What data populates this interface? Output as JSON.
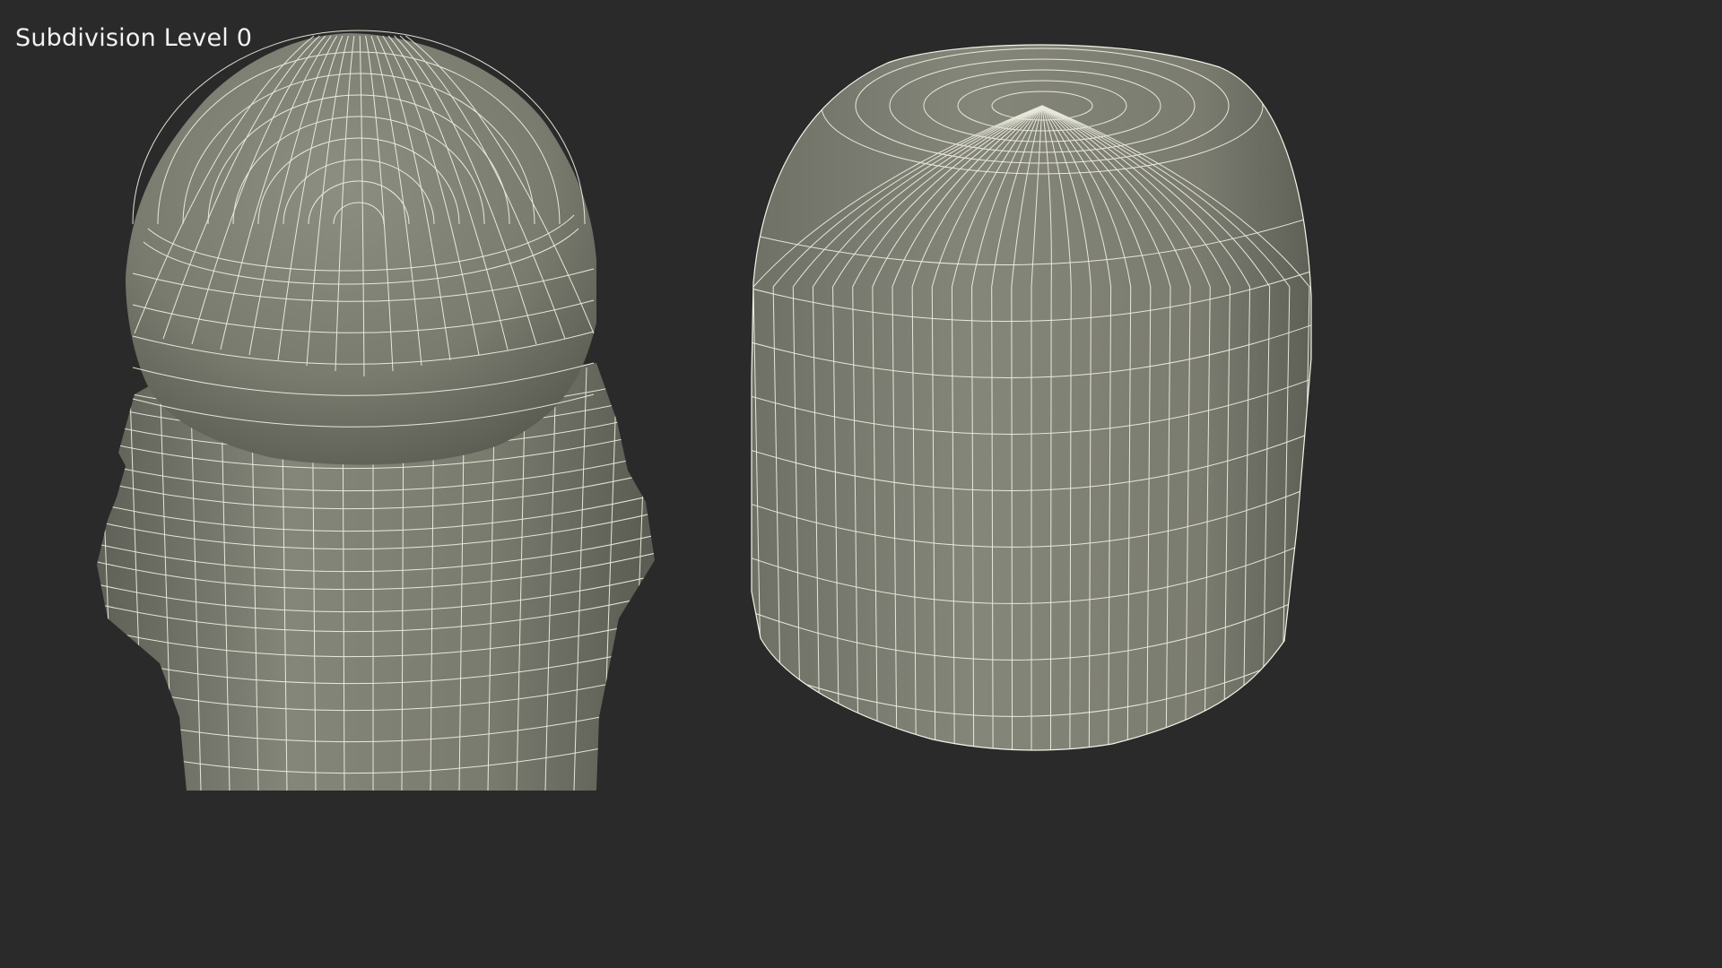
{
  "overlay": {
    "label": "Subdivision Level 0"
  },
  "colors": {
    "background": "#2a2a2a",
    "surface": "#7c7d71",
    "wireframe": "#f4f4e6",
    "label": "#f2f2f2"
  },
  "objects": [
    {
      "name": "roll-on-bottle",
      "description": "wireframe mesh with ball and threaded neck"
    },
    {
      "name": "bottle-cap",
      "description": "wireframe mesh dome cap"
    }
  ]
}
